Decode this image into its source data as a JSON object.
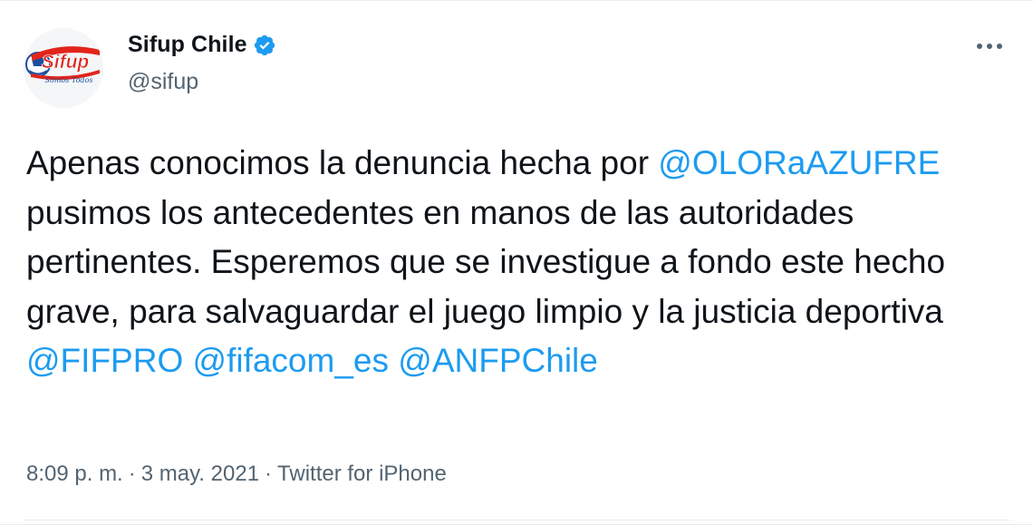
{
  "author": {
    "display_name": "Sifup Chile",
    "handle": "@sifup",
    "verified": true,
    "avatar_logo_text": "Sifup",
    "avatar_logo_subtext": "Somos Todos"
  },
  "icons": {
    "verified": "verified-badge-icon",
    "more": "more-options-icon"
  },
  "colors": {
    "text": "#0f1419",
    "secondary": "#536471",
    "link": "#1d9bf0",
    "verified": "#1d9bf0",
    "logo_red": "#e1251b",
    "logo_blue": "#1d4f9e"
  },
  "tweet": {
    "segments": [
      {
        "text": "Apenas conocimos la denuncia hecha por ",
        "type": "text"
      },
      {
        "text": "@OLORaAZUFRE",
        "type": "mention"
      },
      {
        "text": " pusimos los antecedentes en manos de las autoridades pertinentes. Esperemos que se investigue a fondo este hecho grave, para salvaguardar el juego limpio y la justicia deportiva ",
        "type": "text"
      },
      {
        "text": "@FIFPRO",
        "type": "mention"
      },
      {
        "text": " ",
        "type": "text"
      },
      {
        "text": "@fifacom_es",
        "type": "mention"
      },
      {
        "text": " ",
        "type": "text"
      },
      {
        "text": "@ANFPChile",
        "type": "mention"
      }
    ]
  },
  "meta": {
    "time": "8:09 p. m.",
    "separator": "·",
    "date": "3 may. 2021",
    "source": "Twitter for iPhone"
  }
}
